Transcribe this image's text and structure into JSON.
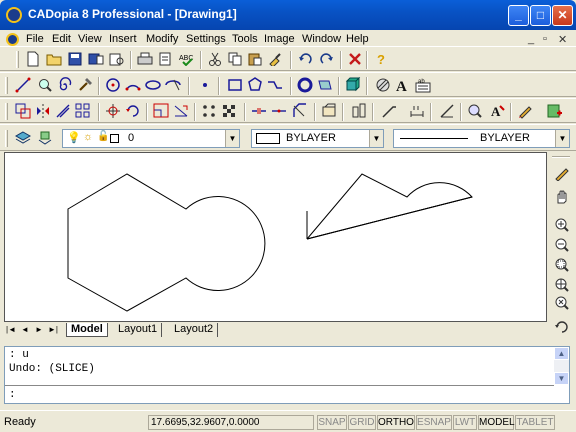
{
  "window": {
    "title": "CADopia 8 Professional  - [Drawing1]",
    "min": "_",
    "max": "□",
    "close": "✕"
  },
  "menu": [
    "File",
    "Edit",
    "View",
    "Insert",
    "Modify",
    "Settings",
    "Tools",
    "Image",
    "Window",
    "Help"
  ],
  "mdi_controls": [
    "_",
    "▫",
    "✕"
  ],
  "layer_combo": {
    "value": "0"
  },
  "color_combo": {
    "value": "BYLAYER"
  },
  "linetype_combo": {
    "value": "BYLAYER"
  },
  "tabs": [
    "Model",
    "Layout1",
    "Layout2"
  ],
  "command": {
    "lines": [
      ": u",
      "Undo: (SLICE)"
    ],
    "prompt": ":"
  },
  "status": {
    "ready": "Ready",
    "coords": "17.6695,32.9607,0.0000",
    "toggles": [
      {
        "label": "SNAP",
        "on": false
      },
      {
        "label": "GRID",
        "on": false
      },
      {
        "label": "ORTHO",
        "on": true
      },
      {
        "label": "ESNAP",
        "on": false
      },
      {
        "label": "LWT",
        "on": false
      },
      {
        "label": "MODEL",
        "on": true
      },
      {
        "label": "TABLET",
        "on": false
      }
    ]
  }
}
